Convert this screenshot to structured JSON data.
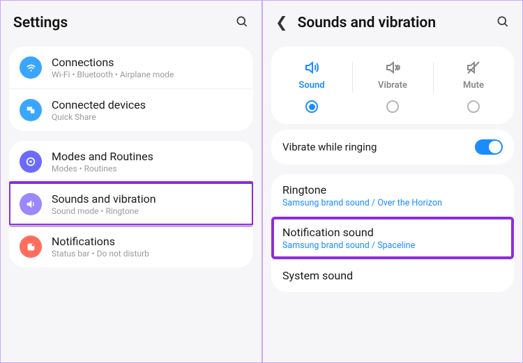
{
  "left": {
    "title": "Settings",
    "groups": [
      {
        "items": [
          {
            "title": "Connections",
            "sub": "Wi-Fi  •  Bluetooth  •  Airplane mode",
            "iconColor": "#3aa6ff",
            "icon": "wifi"
          },
          {
            "title": "Connected devices",
            "sub": "Quick Share",
            "iconColor": "#3aa6ff",
            "icon": "devices"
          }
        ]
      },
      {
        "items": [
          {
            "title": "Modes and Routines",
            "sub": "Modes  •  Routines",
            "iconColor": "#6b6bff",
            "icon": "modes"
          },
          {
            "title": "Sounds and vibration",
            "sub": "Sound mode  •  Ringtone",
            "iconColor": "#9b87ff",
            "icon": "sound",
            "highlight": true
          },
          {
            "title": "Notifications",
            "sub": "Status bar  •  Do not disturb",
            "iconColor": "#ff6e5c",
            "icon": "notif"
          }
        ]
      }
    ]
  },
  "right": {
    "title": "Sounds and vibration",
    "modes": [
      {
        "label": "Sound",
        "active": true
      },
      {
        "label": "Vibrate",
        "active": false
      },
      {
        "label": "Mute",
        "active": false
      }
    ],
    "vibrateRinging": {
      "label": "Vibrate while ringing",
      "on": true
    },
    "list": [
      {
        "title": "Ringtone",
        "sub": "Samsung brand sound / Over the Horizon"
      },
      {
        "title": "Notification sound",
        "sub": "Samsung brand sound / Spaceline",
        "highlight": true
      },
      {
        "title": "System sound",
        "sub": ""
      }
    ]
  }
}
